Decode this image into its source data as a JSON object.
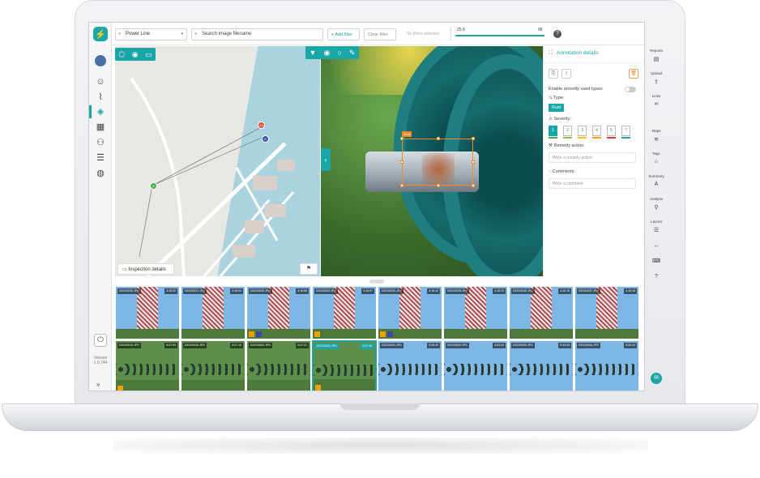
{
  "topbar": {
    "project_select": "Power Line",
    "search_placeholder": "Search image filename",
    "add_filter": "+ Add filter",
    "clear_filter": "Clear filter",
    "no_filters": "No filters selected",
    "slider_min": "25.6",
    "slider_max": "96",
    "help": "?"
  },
  "left_nav": {
    "version_label": "Version",
    "version_value": "1.0.744",
    "collapse": "»"
  },
  "map": {
    "inspection_details": "Inspection details",
    "pins": [
      {
        "label": "24",
        "color": "#e8452c"
      },
      {
        "label": "B",
        "color": "#3949ab"
      },
      {
        "label": "A",
        "color": "#43b047"
      }
    ]
  },
  "photo": {
    "bbox_label": "Rust"
  },
  "annotation": {
    "title": "Annotation details",
    "enable_recent": "Enable recently used types:",
    "type_label": "Type:",
    "type_value": "Rust",
    "severity_label": "Severity:",
    "severity_levels": [
      "1",
      "2",
      "3",
      "4",
      "5",
      "?"
    ],
    "severity_colors": [
      "#43b047",
      "#8bc34a",
      "#ffc107",
      "#ff9800",
      "#e53935",
      "#1aa6a6"
    ],
    "remedy_label": "Remedy action:",
    "remedy_placeholder": "Write a remedy action",
    "comments_label": "Comments:",
    "comments_placeholder": "Write a comment"
  },
  "right_tools": [
    {
      "label": "Reports",
      "icon": "report-icon"
    },
    {
      "label": "Upload",
      "icon": "upload-icon"
    },
    {
      "label": "Links",
      "icon": "link-icon"
    },
    {
      "label": "Maps",
      "icon": "layers-icon"
    },
    {
      "label": "Tags",
      "icon": "tag-icon"
    },
    {
      "label": "Summary",
      "icon": "font-icon"
    },
    {
      "label": "Analyse",
      "icon": "analyse-icon"
    },
    {
      "label": "Layout",
      "icon": "list-icon"
    }
  ],
  "gallery": [
    {
      "name": "DSC00030.JPG",
      "time": "4:15:02",
      "kind": "tower"
    },
    {
      "name": "DSC00031.JPG",
      "time": "4:15:04",
      "kind": "tower"
    },
    {
      "name": "DSC00032.JPG",
      "time": "4:15:05",
      "kind": "tower",
      "badges": [
        "#f0a000",
        "#3949ab"
      ]
    },
    {
      "name": "DSC00033.JPG",
      "time": "4:15:07",
      "kind": "tower",
      "badges": [
        "#f0a000"
      ]
    },
    {
      "name": "DSC00034.JPG",
      "time": "4:15:12",
      "kind": "tower",
      "badges": [
        "#f0a000",
        "#3949ab"
      ]
    },
    {
      "name": "DSC00035.JPG",
      "time": "4:15:13",
      "kind": "tower"
    },
    {
      "name": "DSC00036.JPG",
      "time": "4:15:15",
      "kind": "tower"
    },
    {
      "name": "DSC00037.JPG",
      "time": "4:15:18",
      "kind": "tower"
    },
    {
      "name": "DSC00019.JPG",
      "time": "5:27:09",
      "kind": "forest",
      "badges": [
        "#f0a000"
      ]
    },
    {
      "name": "DSC00020.JPG",
      "time": "5:27:13",
      "kind": "forest"
    },
    {
      "name": "DSC00022.JPG",
      "time": "5:27:21",
      "kind": "forest"
    },
    {
      "name": "DSC00021.JPG",
      "time": "5:27:18",
      "kind": "forest",
      "selected": true,
      "badges": [
        "#f0a000"
      ]
    },
    {
      "name": "DSC00001.JPG",
      "time": "5:33:42",
      "kind": "cable"
    },
    {
      "name": "DSC00002.JPG",
      "time": "5:33:43",
      "kind": "cable"
    },
    {
      "name": "DSC00003.JPG",
      "time": "5:33:43",
      "kind": "cable"
    },
    {
      "name": "DSC00004.JPG",
      "time": "5:33:44",
      "kind": "cable"
    }
  ],
  "colors": {
    "accent": "#1aa6a6",
    "annotation_box": "#f08a24"
  }
}
